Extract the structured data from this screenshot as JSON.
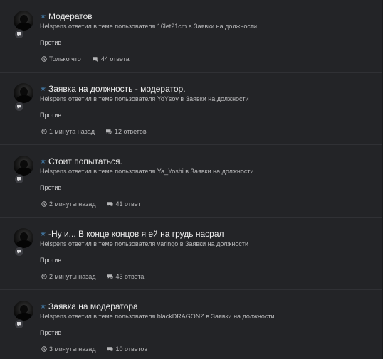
{
  "items": [
    {
      "title": "Модератов",
      "meta": "Helspens ответил в теме пользователя 16let21cm в Заявки на должности",
      "snippet": "Против",
      "time": "Только что",
      "replies": "44 ответа"
    },
    {
      "title": "Заявка на должность - модератор.",
      "meta": "Helspens ответил в теме пользователя YoYsoy в Заявки на должности",
      "snippet": "Против",
      "time": "1 минута назад",
      "replies": "12 ответов"
    },
    {
      "title": "Стоит попытаться.",
      "meta": "Helspens ответил в теме пользователя Ya_Yoshi в Заявки на должности",
      "snippet": "Против",
      "time": "2 минуты назад",
      "replies": "41 ответ"
    },
    {
      "title": "-Ну и... В конце концов я ей на грудь насрал",
      "meta": "Helspens ответил в теме пользователя varingo в Заявки на должности",
      "snippet": "Против",
      "time": "2 минуты назад",
      "replies": "43 ответа"
    },
    {
      "title": "Заявка на модератора",
      "meta": "Helspens ответил в теме пользователя blackDRAGONZ в Заявки на должности",
      "snippet": "Против",
      "time": "3 минуты назад",
      "replies": "10 ответов"
    }
  ],
  "icons": {
    "star": "star-icon",
    "avatar_badge": "comment-bubble-icon",
    "time": "clock-icon",
    "replies": "comments-icon"
  },
  "colors": {
    "background": "#232427",
    "star": "#3f6f96",
    "title": "#ececec",
    "text": "#b9b9bb"
  }
}
